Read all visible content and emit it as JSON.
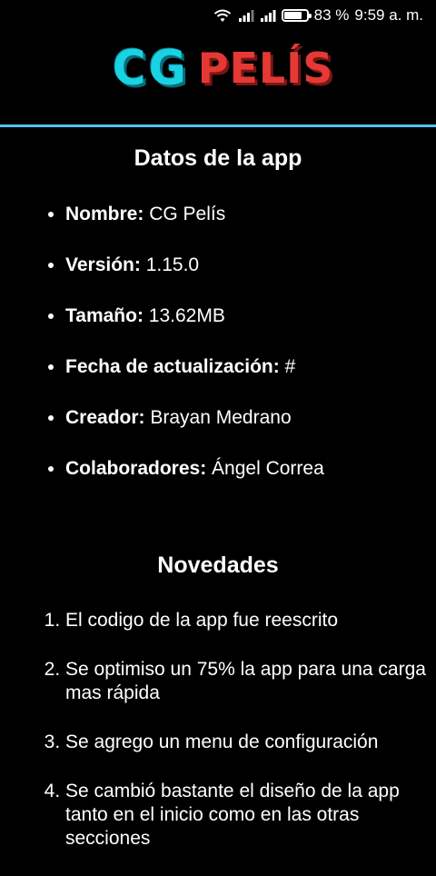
{
  "status_bar": {
    "battery_percent": "83 %",
    "battery_level": 0.83,
    "time": "9:59 a. m."
  },
  "header": {
    "logo_part1": "CG",
    "logo_part2": "PELÍS",
    "accent_line_color": "#4fc3f7"
  },
  "app_info": {
    "title": "Datos de la app",
    "items": [
      {
        "label": "Nombre:",
        "value": "CG Pelís"
      },
      {
        "label": "Versión:",
        "value": "1.15.0"
      },
      {
        "label": "Tamaño:",
        "value": "13.62MB"
      },
      {
        "label": "Fecha de actualización:",
        "value": "#"
      },
      {
        "label": "Creador:",
        "value": "Brayan Medrano"
      },
      {
        "label": "Colaboradores:",
        "value": "Ángel Correa"
      }
    ]
  },
  "news": {
    "title": "Novedades",
    "items": [
      "El codigo de la app fue reescrito",
      "Se optimiso un 75% la app para una carga mas rápida",
      "Se agrego un menu de configuración",
      "Se cambió bastante el diseño de la app tanto en el inicio como en las otras secciones"
    ]
  }
}
